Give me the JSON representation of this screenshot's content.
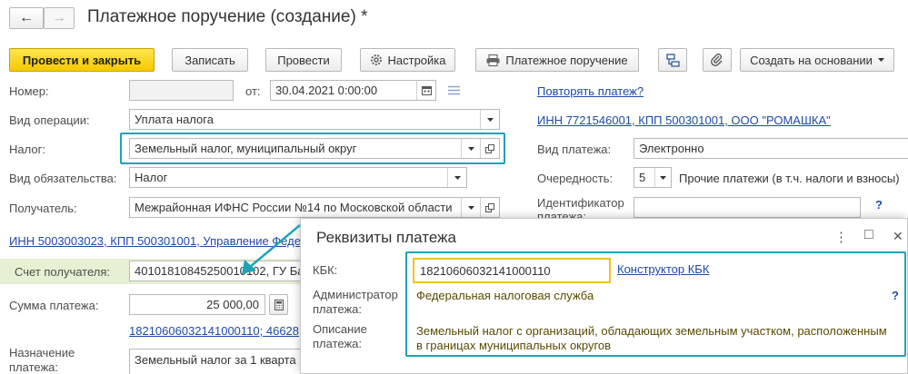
{
  "window": {
    "title": "Платежное поручение (создание) *",
    "nav_back": "←",
    "nav_forward": "→"
  },
  "toolbar": {
    "post_close": "Провести и закрыть",
    "save": "Записать",
    "post": "Провести",
    "settings": "Настройка",
    "payment_order": "Платежное поручение",
    "create_based_on": "Создать на основании"
  },
  "form": {
    "number_label": "Номер:",
    "number_value": "",
    "date_from_label": "от:",
    "date_value": "30.04.2021  0:00:00",
    "repeat_link": "Повторять платеж?",
    "operation_label": "Вид операции:",
    "operation_value": "Уплата налога",
    "org_link": "ИНН 7721546001, КПП 500301001, ООО \"РОМАШКА\"",
    "tax_label": "Налог:",
    "tax_value": "Земельный налог, муниципальный округ",
    "payment_kind_label": "Вид платежа:",
    "payment_kind_value": "Электронно",
    "obligation_label": "Вид обязательства:",
    "obligation_value": "Налог",
    "priority_label": "Очередность:",
    "priority_value": "5",
    "priority_text": "Прочие платежи (в т.ч. налоги и взносы)",
    "recipient_label": "Получатель:",
    "recipient_value": "Межрайонная ИФНС России №14 по Московской области",
    "identifier_label_1": "Идентификатор",
    "identifier_label_2": "платежа:",
    "identifier_help": "?",
    "recipient_link": "ИНН 5003003023, КПП 500301001, Управление Феде",
    "account_label": "Счет получателя:",
    "account_value": "40101810845250010102, ГУ Ба",
    "amount_label": "Сумма платежа:",
    "amount_value": "25 000,00",
    "kbk_link": "18210606032141000110; 46628",
    "purpose_label_1": "Назначение",
    "purpose_label_2": "платежа:",
    "purpose_value": "Земельный налог за 1 кварта"
  },
  "popup": {
    "title": "Реквизиты платежа",
    "menu_icon": "⋮",
    "maximize_icon": "□",
    "close_icon": "✕",
    "kbk_label": "КБК:",
    "kbk_value": "18210606032141000110",
    "kbk_constructor_link": "Конструктор КБК",
    "admin_label_1": "Администратор",
    "admin_label_2": "платежа:",
    "admin_value": "Федеральная налоговая служба",
    "admin_help": "?",
    "desc_label_1": "Описание",
    "desc_label_2": "платежа:",
    "desc_value_1": "Земельный налог с организаций, обладающих земельным участком, расположенным",
    "desc_value_2": "в границах муниципальных округов"
  },
  "colors": {
    "accent_highlight": "#1ea3b8",
    "kbk_highlight": "#f0c419",
    "primary_button": "#f5c900",
    "link": "#1c4aa5"
  }
}
